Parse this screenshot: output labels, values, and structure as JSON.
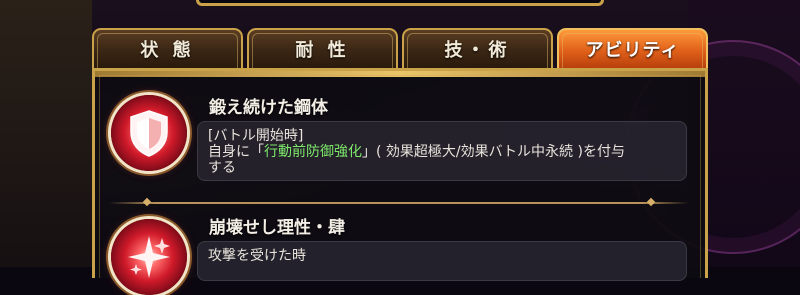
{
  "tabs": [
    {
      "label": "状 態",
      "active": false
    },
    {
      "label": "耐 性",
      "active": false
    },
    {
      "label": "技・術",
      "active": false
    },
    {
      "label": "アビリティ",
      "active": true
    }
  ],
  "abilities": [
    {
      "name": "鍛え続けた鋼体",
      "icon": "shield-icon",
      "desc_line1": "[バトル開始時]",
      "desc_pre": "自身に「",
      "desc_highlight": "行動前防御強化",
      "desc_post": "」( 効果超極大/効果バトル中永続 )を付与",
      "desc_line3": "する"
    },
    {
      "name": "崩壊せし理性・肆",
      "icon": "sparkle-icon",
      "desc_line1": "攻撃を受けた時"
    }
  ],
  "colors": {
    "gold_frame": "#c9a24a",
    "active_tab": "#e0601a",
    "highlight_text": "#7ee86a",
    "icon_red": "#d01a2a"
  }
}
